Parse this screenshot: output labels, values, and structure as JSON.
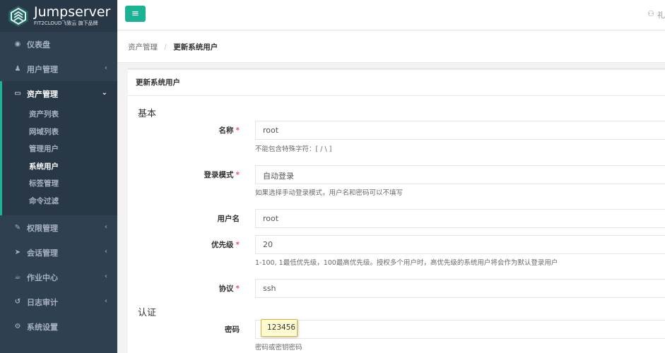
{
  "brand": {
    "title": "Jumpserver",
    "subtitle": "FIT2CLOUD飞致云 旗下品牌"
  },
  "sidebar": {
    "items": [
      {
        "label": "仪表盘",
        "icon": "dashboard-icon"
      },
      {
        "label": "用户管理",
        "icon": "users-icon",
        "arrow": "‹"
      },
      {
        "label": "资产管理",
        "icon": "inbox-icon",
        "arrow": "⌄",
        "active": true
      },
      {
        "label": "权限管理",
        "icon": "edit-icon",
        "arrow": "‹"
      },
      {
        "label": "会话管理",
        "icon": "paper-plane-icon",
        "arrow": "‹"
      },
      {
        "label": "作业中心",
        "icon": "coffee-icon",
        "arrow": "‹"
      },
      {
        "label": "日志审计",
        "icon": "history-icon",
        "arrow": "‹"
      },
      {
        "label": "系统设置",
        "icon": "gears-icon"
      }
    ],
    "submenu": [
      "资产列表",
      "网域列表",
      "管理用户",
      "系统用户",
      "标签管理",
      "命令过滤"
    ]
  },
  "topbar": {
    "right_text": "礼"
  },
  "breadcrumb": {
    "parent": "资产管理",
    "separator": "/",
    "current": "更新系统用户"
  },
  "panel": {
    "title": "更新系统用户"
  },
  "form": {
    "section_basic": "基本",
    "section_auth": "认证",
    "name": {
      "label": "名称",
      "required": "*",
      "value": "root",
      "help": "不能包含特殊字符：[ / \\ ]"
    },
    "login_mode": {
      "label": "登录模式",
      "required": "*",
      "value": "自动登录",
      "help": "如果选择手动登录模式，用户名和密码可以不填写"
    },
    "username": {
      "label": "用户名",
      "value": "root"
    },
    "priority": {
      "label": "优先级",
      "required": "*",
      "value": "20",
      "help": "1-100, 1最低优先级，100最高优先级。授权多个用户时，高优先级的系统用户将会作为默认登录用户"
    },
    "protocol": {
      "label": "协议",
      "required": "*",
      "value": "ssh"
    },
    "password": {
      "label": "密码",
      "value": "123456",
      "help": "密码或密钥密码"
    }
  },
  "colors": {
    "sidebar_bg": "#2f4050",
    "accent": "#1ab394",
    "required": "#ed5565",
    "highlight": "#fffbd0"
  }
}
